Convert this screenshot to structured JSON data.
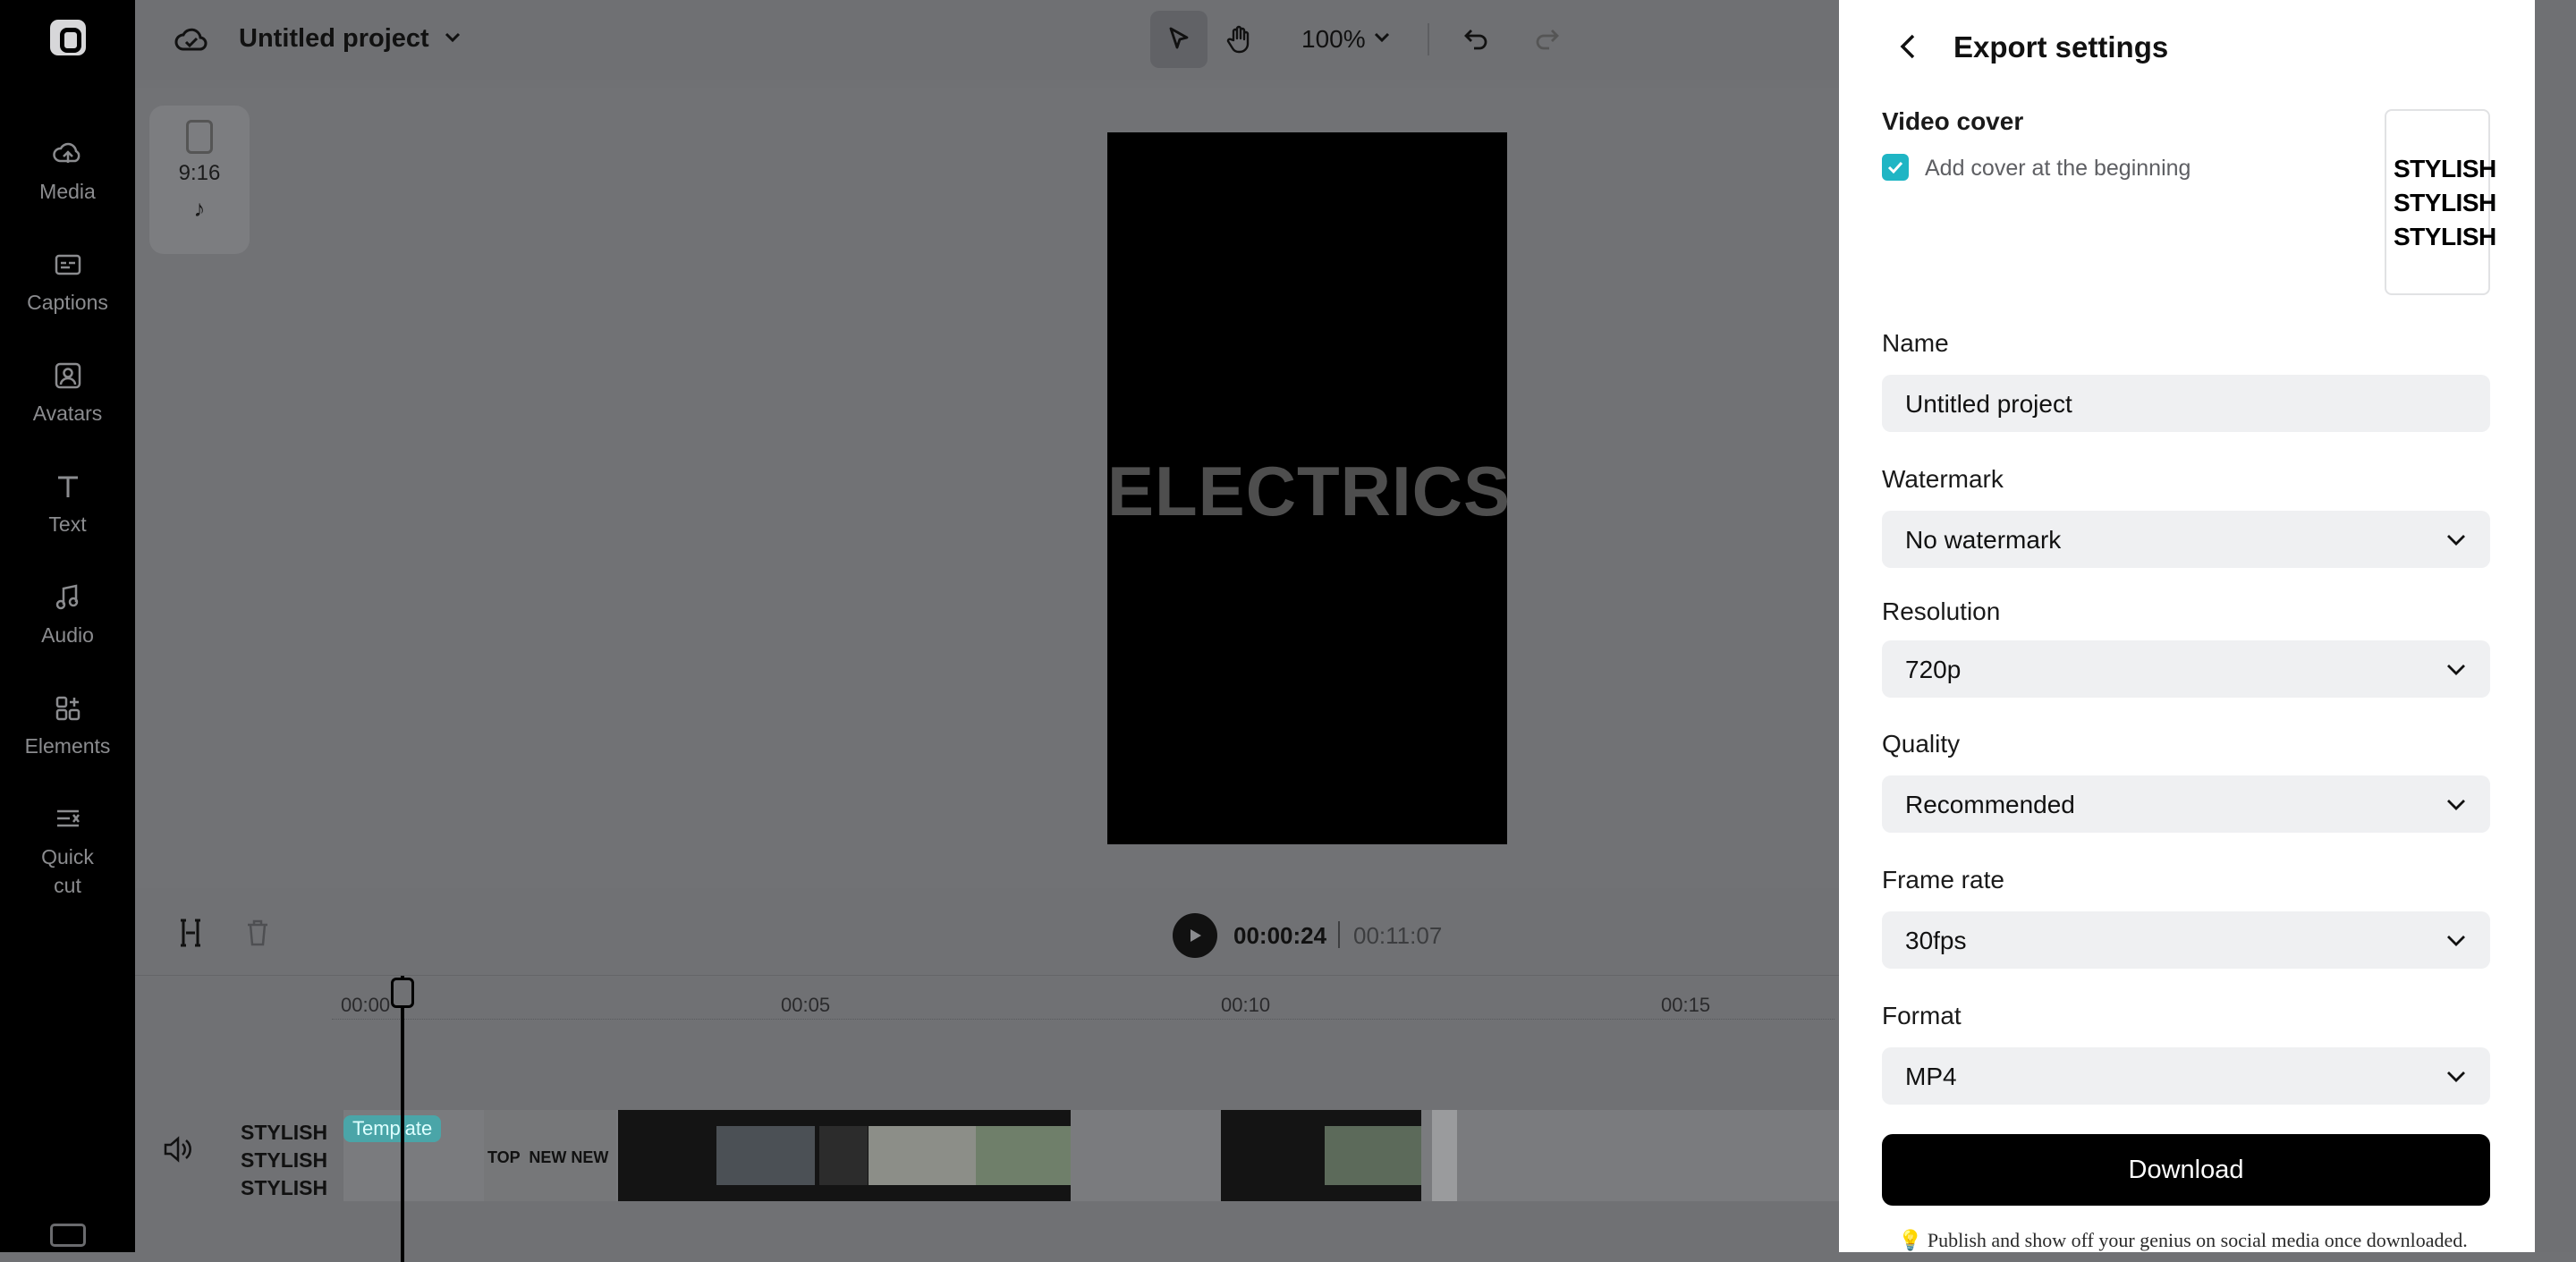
{
  "sidebar": {
    "items": [
      {
        "label": "Media",
        "icon": "media-cloud-icon"
      },
      {
        "label": "Captions",
        "icon": "captions-icon"
      },
      {
        "label": "Avatars",
        "icon": "avatar-icon"
      },
      {
        "label": "Text",
        "icon": "text-icon"
      },
      {
        "label": "Audio",
        "icon": "music-note-icon"
      },
      {
        "label": "Elements",
        "icon": "elements-grid-icon"
      },
      {
        "label": "Quick cut",
        "icon": "quick-cut-icon"
      }
    ]
  },
  "header": {
    "project_title": "Untitled project",
    "zoom": "100%"
  },
  "canvas": {
    "aspect_ratio": "9:16",
    "headline": "ELECTRICS"
  },
  "playback": {
    "current_time": "00:00:24",
    "total_time": "00:11:07"
  },
  "timeline": {
    "ticks": [
      "00:00",
      "00:05",
      "00:10",
      "00:15"
    ],
    "cover_text": [
      "STYLISH",
      "STYLISH",
      "STYLISH"
    ],
    "template_badge": "Template"
  },
  "export": {
    "title": "Export settings",
    "video_cover": {
      "label": "Video cover",
      "checkbox_label": "Add cover at the beginning",
      "checked": true,
      "preview_lines": [
        "STYLISH",
        "STYLISH",
        "STYLISH"
      ]
    },
    "name": {
      "label": "Name",
      "value": "Untitled project"
    },
    "watermark": {
      "label": "Watermark",
      "value": "No watermark"
    },
    "resolution": {
      "label": "Resolution",
      "value": "720p"
    },
    "quality": {
      "label": "Quality",
      "value": "Recommended"
    },
    "frame_rate": {
      "label": "Frame rate",
      "value": "30fps"
    },
    "format": {
      "label": "Format",
      "value": "MP4"
    },
    "download_label": "Download",
    "tip": "💡 Publish and show off your genius on social media once downloaded."
  },
  "colors": {
    "accent": "#1fb5c4",
    "overlay": "#707174",
    "download_button": "#000000"
  }
}
